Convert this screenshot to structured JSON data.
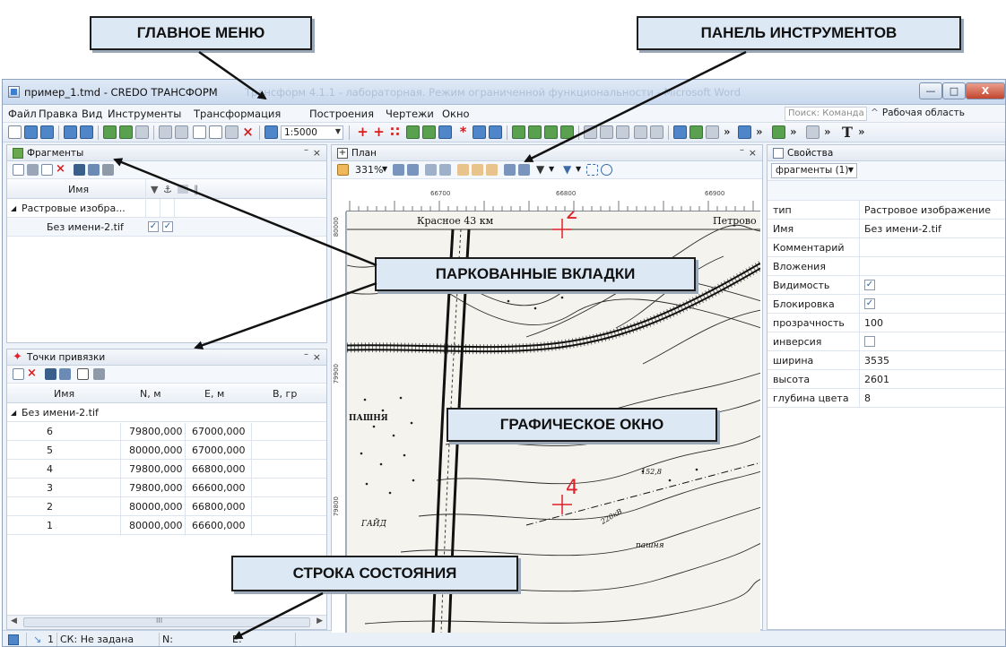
{
  "window": {
    "title": "пример_1.tmd - CREDO ТРАНСФОРМ",
    "title_ghost": "Трансформ 4.1.1 - лабораторная. Режим ограниченной функциональности - Microsoft Word",
    "min_glyph": "—",
    "max_glyph": "□",
    "close_glyph": "X"
  },
  "menu": {
    "items": [
      "Файл",
      "Правка",
      "Вид",
      "Инструменты",
      "Трансформация",
      "Построения",
      "Чертежи",
      "Окно"
    ],
    "search_text": "Поиск: Команда (Ctrl ...",
    "workspace": "Рабочая область"
  },
  "toolbar": {
    "scale": "1:5000",
    "text_tool": "T",
    "more": "»"
  },
  "fragments_panel": {
    "title": "Фрагменты",
    "col_name": "Имя",
    "tree_root": "Растровые изобра...",
    "tree_child": "Без имени-2.tif",
    "pin": "–",
    "close": "×"
  },
  "points_panel": {
    "title": "Точки привязки",
    "columns": [
      "Имя",
      "N, м",
      "E, м",
      "В, гр"
    ],
    "group": "Без имени-2.tif",
    "rows": [
      [
        "6",
        "79800,000",
        "67000,000"
      ],
      [
        "5",
        "80000,000",
        "67000,000"
      ],
      [
        "4",
        "79800,000",
        "66800,000"
      ],
      [
        "3",
        "79800,000",
        "66600,000"
      ],
      [
        "2",
        "80000,000",
        "66800,000"
      ],
      [
        "1",
        "80000,000",
        "66600,000"
      ]
    ],
    "scroll_mark": "III"
  },
  "plan_panel": {
    "title": "План",
    "zoom": "331%",
    "ruler_h": [
      "66700",
      "66800",
      "66900"
    ],
    "ruler_v": [
      "80000",
      "79900",
      "79800"
    ],
    "map_labels": {
      "red_2": "2",
      "red_4": "4",
      "village_1": "Красное 43 км",
      "village_2": "Петрово",
      "misc_1": "ПАШНЯ",
      "misc_2": "ГАЙД",
      "misc_3": "152,8",
      "misc_4": "220кВ",
      "misc_5": "пашня"
    }
  },
  "props_panel": {
    "title": "Свойства",
    "selector": "фрагменты (1)",
    "rows": [
      {
        "key": "тип",
        "value": "Растровое изображение"
      },
      {
        "key": "Имя",
        "value": "Без имени-2.tif"
      },
      {
        "key": "Комментарий",
        "value": ""
      },
      {
        "key": "Вложения",
        "value": ""
      },
      {
        "key": "Видимость",
        "value": ""
      },
      {
        "key": "Блокировка",
        "value": ""
      },
      {
        "key": "прозрачность",
        "value": "100"
      },
      {
        "key": "инверсия",
        "value": ""
      },
      {
        "key": "ширина",
        "value": "3535"
      },
      {
        "key": "высота",
        "value": "2601"
      },
      {
        "key": "глубина цвета",
        "value": "8"
      }
    ],
    "checked": {
      "visibility": true,
      "lock": true,
      "inversion": false
    }
  },
  "status": {
    "count": "1",
    "sk": "СК: Не задана",
    "n": "N:",
    "e": "E:"
  },
  "callouts": {
    "main_menu": "ГЛАВНОЕ МЕНЮ",
    "toolbar": "ПАНЕЛЬ ИНСТРУМЕНТОВ",
    "docked_tabs": "ПАРКОВАННЫЕ ВКЛАДКИ",
    "graphic_window": "ГРАФИЧЕСКОЕ ОКНО",
    "status_bar": "СТРОКА СОСТОЯНИЯ"
  },
  "colors": {
    "accent": "#4f86c9",
    "marker_red": "#e0202a",
    "callout_bg": "#dce8f4"
  }
}
